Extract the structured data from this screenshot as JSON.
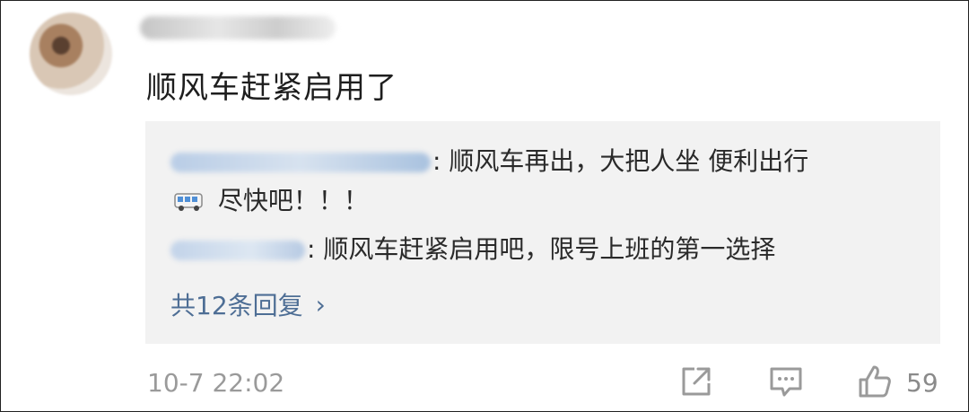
{
  "comment": {
    "text": "顺风车赶紧启用了"
  },
  "replies": [
    {
      "text": ": 顺风车再出，大把人坐 便利出行",
      "icon": "bus-icon",
      "suffix": " 尽快吧！！！"
    },
    {
      "text": ": 顺风车赶紧启用吧，限号上班的第一选择"
    }
  ],
  "more_replies_label": "共12条回复",
  "more_chevron": "›",
  "timestamp": "10-7 22:02",
  "like_count": "59",
  "colors": {
    "link": "#4e6e95",
    "reply_bg": "#f2f2f2",
    "meta": "#9a9a9a"
  }
}
